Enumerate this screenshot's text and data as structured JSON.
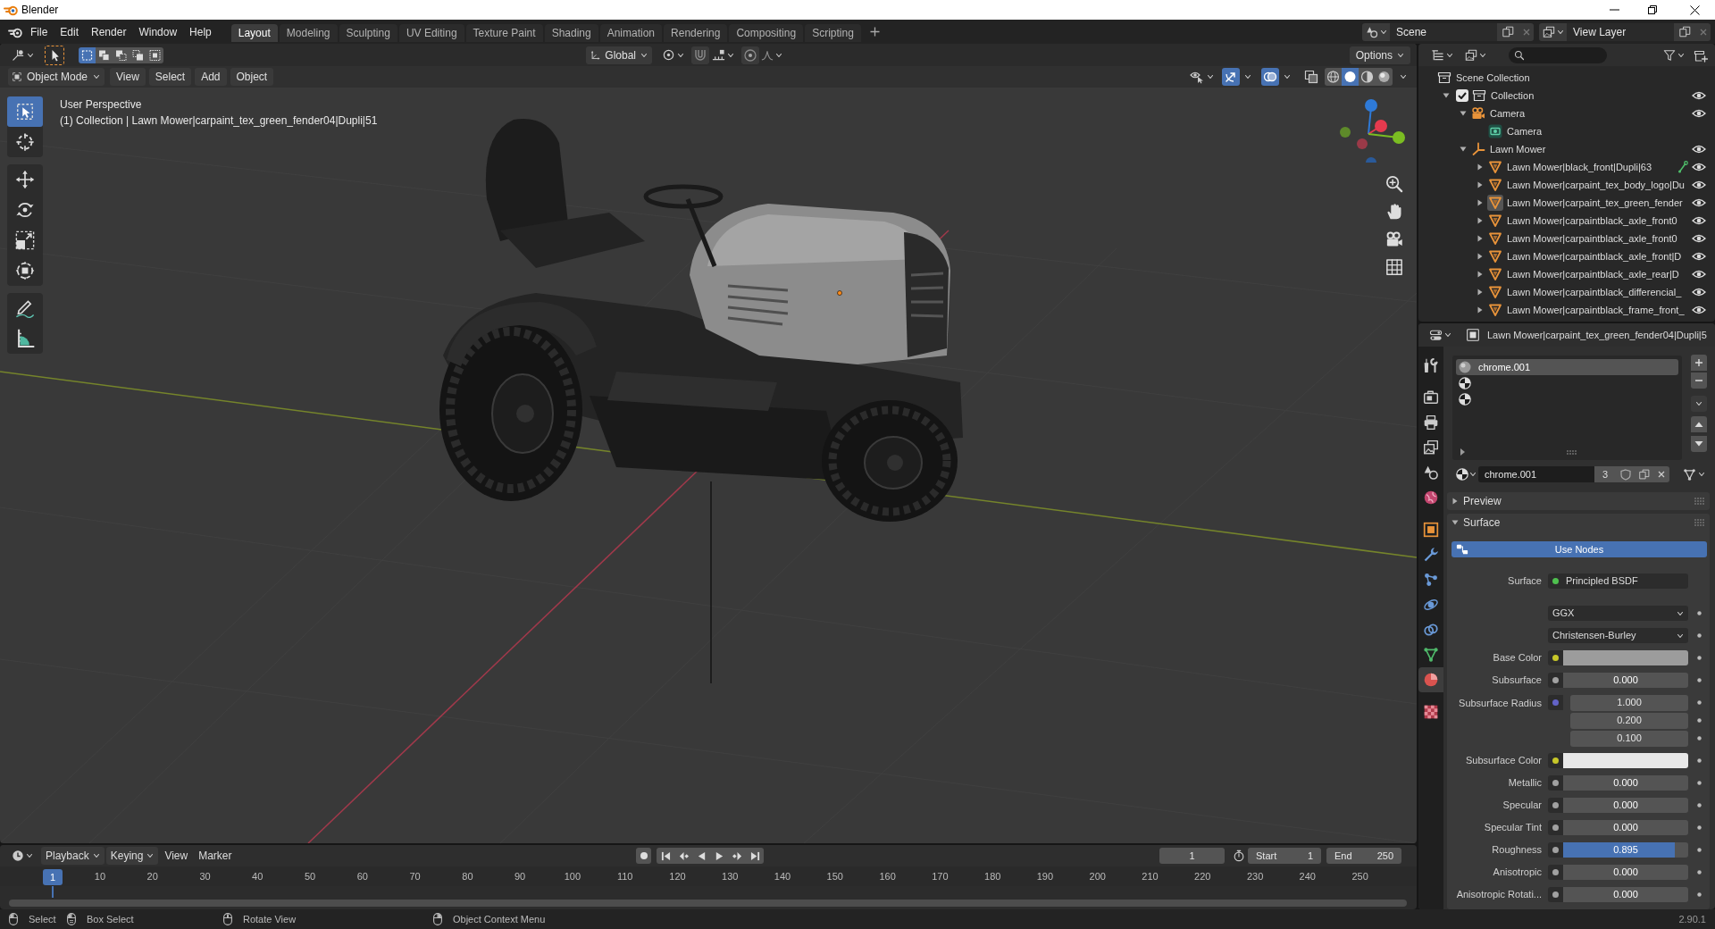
{
  "window": {
    "title": "Blender"
  },
  "top_bar": {
    "menus": [
      "File",
      "Edit",
      "Render",
      "Window",
      "Help"
    ],
    "workspaces": [
      {
        "label": "Layout",
        "selected": true
      },
      {
        "label": "Modeling",
        "selected": false
      },
      {
        "label": "Sculpting",
        "selected": false
      },
      {
        "label": "UV Editing",
        "selected": false
      },
      {
        "label": "Texture Paint",
        "selected": false
      },
      {
        "label": "Shading",
        "selected": false
      },
      {
        "label": "Animation",
        "selected": false
      },
      {
        "label": "Rendering",
        "selected": false
      },
      {
        "label": "Compositing",
        "selected": false
      },
      {
        "label": "Scripting",
        "selected": false
      }
    ],
    "scene": "Scene",
    "view_layer": "View Layer"
  },
  "tool_settings": {
    "selection_modes": [
      {
        "kind": "set",
        "selected": true
      },
      {
        "kind": "extend",
        "selected": false
      },
      {
        "kind": "subtract",
        "selected": false
      },
      {
        "kind": "invert",
        "selected": false
      },
      {
        "kind": "intersect",
        "selected": false
      }
    ],
    "orientation": "Global",
    "options": "Options"
  },
  "viewport_header": {
    "mode": "Object Mode",
    "menus": [
      "View",
      "Select",
      "Add",
      "Object"
    ],
    "gizmos": true,
    "overlays": true,
    "xray": false,
    "shading": [
      {
        "kind": "wireframe",
        "selected": false
      },
      {
        "kind": "solid",
        "selected": true
      },
      {
        "kind": "material",
        "selected": false
      },
      {
        "kind": "rendered",
        "selected": false
      }
    ]
  },
  "viewport": {
    "view_name": "User Perspective",
    "object_info": "(1) Collection | Lawn Mower|carpaint_tex_green_fender04|Dupli|51",
    "toolbar": [
      [
        {
          "kind": "select_box",
          "selected": true
        },
        {
          "kind": "cursor",
          "selected": false
        }
      ],
      [
        {
          "kind": "move",
          "selected": false
        },
        {
          "kind": "rotate",
          "selected": false
        },
        {
          "kind": "scale",
          "selected": false
        },
        {
          "kind": "transform",
          "selected": false
        }
      ],
      [
        {
          "kind": "annotate",
          "selected": false
        },
        {
          "kind": "measure",
          "selected": false
        }
      ]
    ]
  },
  "outliner": {
    "items": [
      {
        "label": "Scene Collection",
        "kind": "scene_collection",
        "selected": false,
        "children": [
          {
            "label": "Collection",
            "kind": "collection",
            "expanded": true,
            "checked": true,
            "visible": true,
            "selected": false,
            "children": [
              {
                "label": "Camera",
                "kind": "camera",
                "expanded": true,
                "visible": true,
                "selected": false,
                "children": [
                  {
                    "label": "Camera",
                    "kind": "camera_data",
                    "selected": false
                  }
                ]
              },
              {
                "label": "Lawn Mower",
                "kind": "empty",
                "expanded": true,
                "visible": true,
                "selected": false,
                "children": [
                  {
                    "label": "Lawn Mower|black_front|Dupli|63",
                    "kind": "mesh",
                    "expanded": false,
                    "visible": true,
                    "selected": false,
                    "bone": true
                  },
                  {
                    "label": "Lawn Mower|carpaint_tex_body_logo|Du",
                    "kind": "mesh",
                    "expanded": false,
                    "visible": true,
                    "selected": false,
                    "bone": false
                  },
                  {
                    "label": "Lawn Mower|carpaint_tex_green_fender",
                    "kind": "mesh",
                    "expanded": false,
                    "visible": true,
                    "selected": true,
                    "bone": false
                  },
                  {
                    "label": "Lawn Mower|carpaintblack_axle_front0",
                    "kind": "mesh",
                    "expanded": false,
                    "visible": true,
                    "selected": false,
                    "bone": false
                  },
                  {
                    "label": "Lawn Mower|carpaintblack_axle_front0",
                    "kind": "mesh",
                    "expanded": false,
                    "visible": true,
                    "selected": false,
                    "bone": false
                  },
                  {
                    "label": "Lawn Mower|carpaintblack_axle_front|D",
                    "kind": "mesh",
                    "expanded": false,
                    "visible": true,
                    "selected": false,
                    "bone": false
                  },
                  {
                    "label": "Lawn Mower|carpaintblack_axle_rear|D",
                    "kind": "mesh",
                    "expanded": false,
                    "visible": true,
                    "selected": false,
                    "bone": false
                  },
                  {
                    "label": "Lawn Mower|carpaintblack_differencial_",
                    "kind": "mesh",
                    "expanded": false,
                    "visible": true,
                    "selected": false,
                    "bone": false
                  },
                  {
                    "label": "Lawn Mower|carpaintblack_frame_front_",
                    "kind": "mesh",
                    "expanded": false,
                    "visible": true,
                    "selected": false,
                    "bone": false
                  }
                ]
              }
            ]
          }
        ]
      }
    ]
  },
  "properties": {
    "path": "Lawn Mower|carpaint_tex_green_fender04|Dupli|5",
    "tabs": [
      [
        {
          "kind": "tool",
          "selected": false
        }
      ],
      [
        {
          "kind": "render",
          "selected": false
        },
        {
          "kind": "output",
          "selected": false
        },
        {
          "kind": "view_layer",
          "selected": false
        },
        {
          "kind": "scene",
          "selected": false
        },
        {
          "kind": "world",
          "selected": false
        }
      ],
      [
        {
          "kind": "object",
          "selected": false
        },
        {
          "kind": "modifiers",
          "selected": false
        },
        {
          "kind": "particles",
          "selected": false
        },
        {
          "kind": "physics",
          "selected": false
        },
        {
          "kind": "constraints",
          "selected": false
        },
        {
          "kind": "data",
          "selected": false
        },
        {
          "kind": "material",
          "selected": true
        }
      ],
      [
        {
          "kind": "texture",
          "selected": false
        }
      ]
    ],
    "material_slots": [
      {
        "kind": "material",
        "label": "chrome.001",
        "selected": true
      },
      {
        "kind": "empty",
        "selected": false
      },
      {
        "kind": "empty",
        "selected": false
      }
    ],
    "material": {
      "name": "chrome.001",
      "users": "3"
    },
    "panels": [
      {
        "label": "Preview",
        "expanded": false
      },
      {
        "label": "Surface",
        "expanded": true,
        "use_nodes": {
          "label": "Use Nodes",
          "on": true
        },
        "fields": [
          {
            "kind": "shader",
            "label": "Surface",
            "socket": {
              "color": "#4fc04f"
            },
            "value": "Principled BSDF"
          },
          {
            "kind": "dropdown",
            "value": "GGX"
          },
          {
            "kind": "dropdown",
            "value": "Christensen-Burley"
          },
          {
            "kind": "color",
            "label": "Base Color",
            "socket": {
              "color": "#c7c729"
            },
            "color": "#9c9c9c"
          },
          {
            "kind": "slider",
            "label": "Subsurface",
            "socket": {
              "color": "#a1a1a1"
            },
            "value": "0.000",
            "level": 0
          },
          {
            "kind": "vector",
            "label": "Subsurface Radius",
            "socket": {
              "color": "#6363c7"
            },
            "values": [
              "1.000",
              "0.200",
              "0.100"
            ]
          },
          {
            "kind": "color",
            "label": "Subsurface Color",
            "socket": {
              "color": "#c7c729"
            },
            "color": "#e8e8e8"
          },
          {
            "kind": "slider",
            "label": "Metallic",
            "socket": {
              "color": "#a1a1a1"
            },
            "value": "0.000",
            "level": 0
          },
          {
            "kind": "slider",
            "label": "Specular",
            "socket": {
              "color": "#a1a1a1"
            },
            "value": "0.000",
            "level": 0
          },
          {
            "kind": "slider",
            "label": "Specular Tint",
            "socket": {
              "color": "#a1a1a1"
            },
            "value": "0.000",
            "level": 0
          },
          {
            "kind": "slider",
            "label": "Roughness",
            "socket": {
              "color": "#a1a1a1"
            },
            "value": "0.895",
            "level": 0.895
          },
          {
            "kind": "slider",
            "label": "Anisotropic",
            "socket": {
              "color": "#a1a1a1"
            },
            "value": "0.000",
            "level": 0
          },
          {
            "kind": "slider",
            "label": "Anisotropic Rotati...",
            "socket": {
              "color": "#a1a1a1"
            },
            "value": "0.000",
            "level": 0
          }
        ]
      }
    ]
  },
  "timeline": {
    "menus": [
      {
        "label": "Playback",
        "kind": "popover"
      },
      {
        "label": "Keying",
        "kind": "popover"
      },
      {
        "label": "View",
        "kind": "menu"
      },
      {
        "label": "Marker",
        "kind": "menu"
      }
    ],
    "current_frame": "1",
    "start": {
      "label": "Start",
      "value": "1"
    },
    "end": {
      "label": "End",
      "value": "250"
    },
    "playhead": "1",
    "ruler": [
      "10",
      "20",
      "30",
      "40",
      "50",
      "60",
      "70",
      "80",
      "90",
      "100",
      "110",
      "120",
      "130",
      "140",
      "150",
      "160",
      "170",
      "180",
      "190",
      "200",
      "210",
      "220",
      "230",
      "240",
      "250"
    ]
  },
  "status_bar": {
    "hints": [
      {
        "kind": "left_click",
        "label": "Select"
      },
      {
        "kind": "left_drag",
        "label": "Box Select"
      },
      {
        "kind": "middle_click",
        "label": "Rotate View"
      },
      {
        "kind": "right_click",
        "label": "Object Context Menu"
      }
    ],
    "version": "2.90.1"
  }
}
